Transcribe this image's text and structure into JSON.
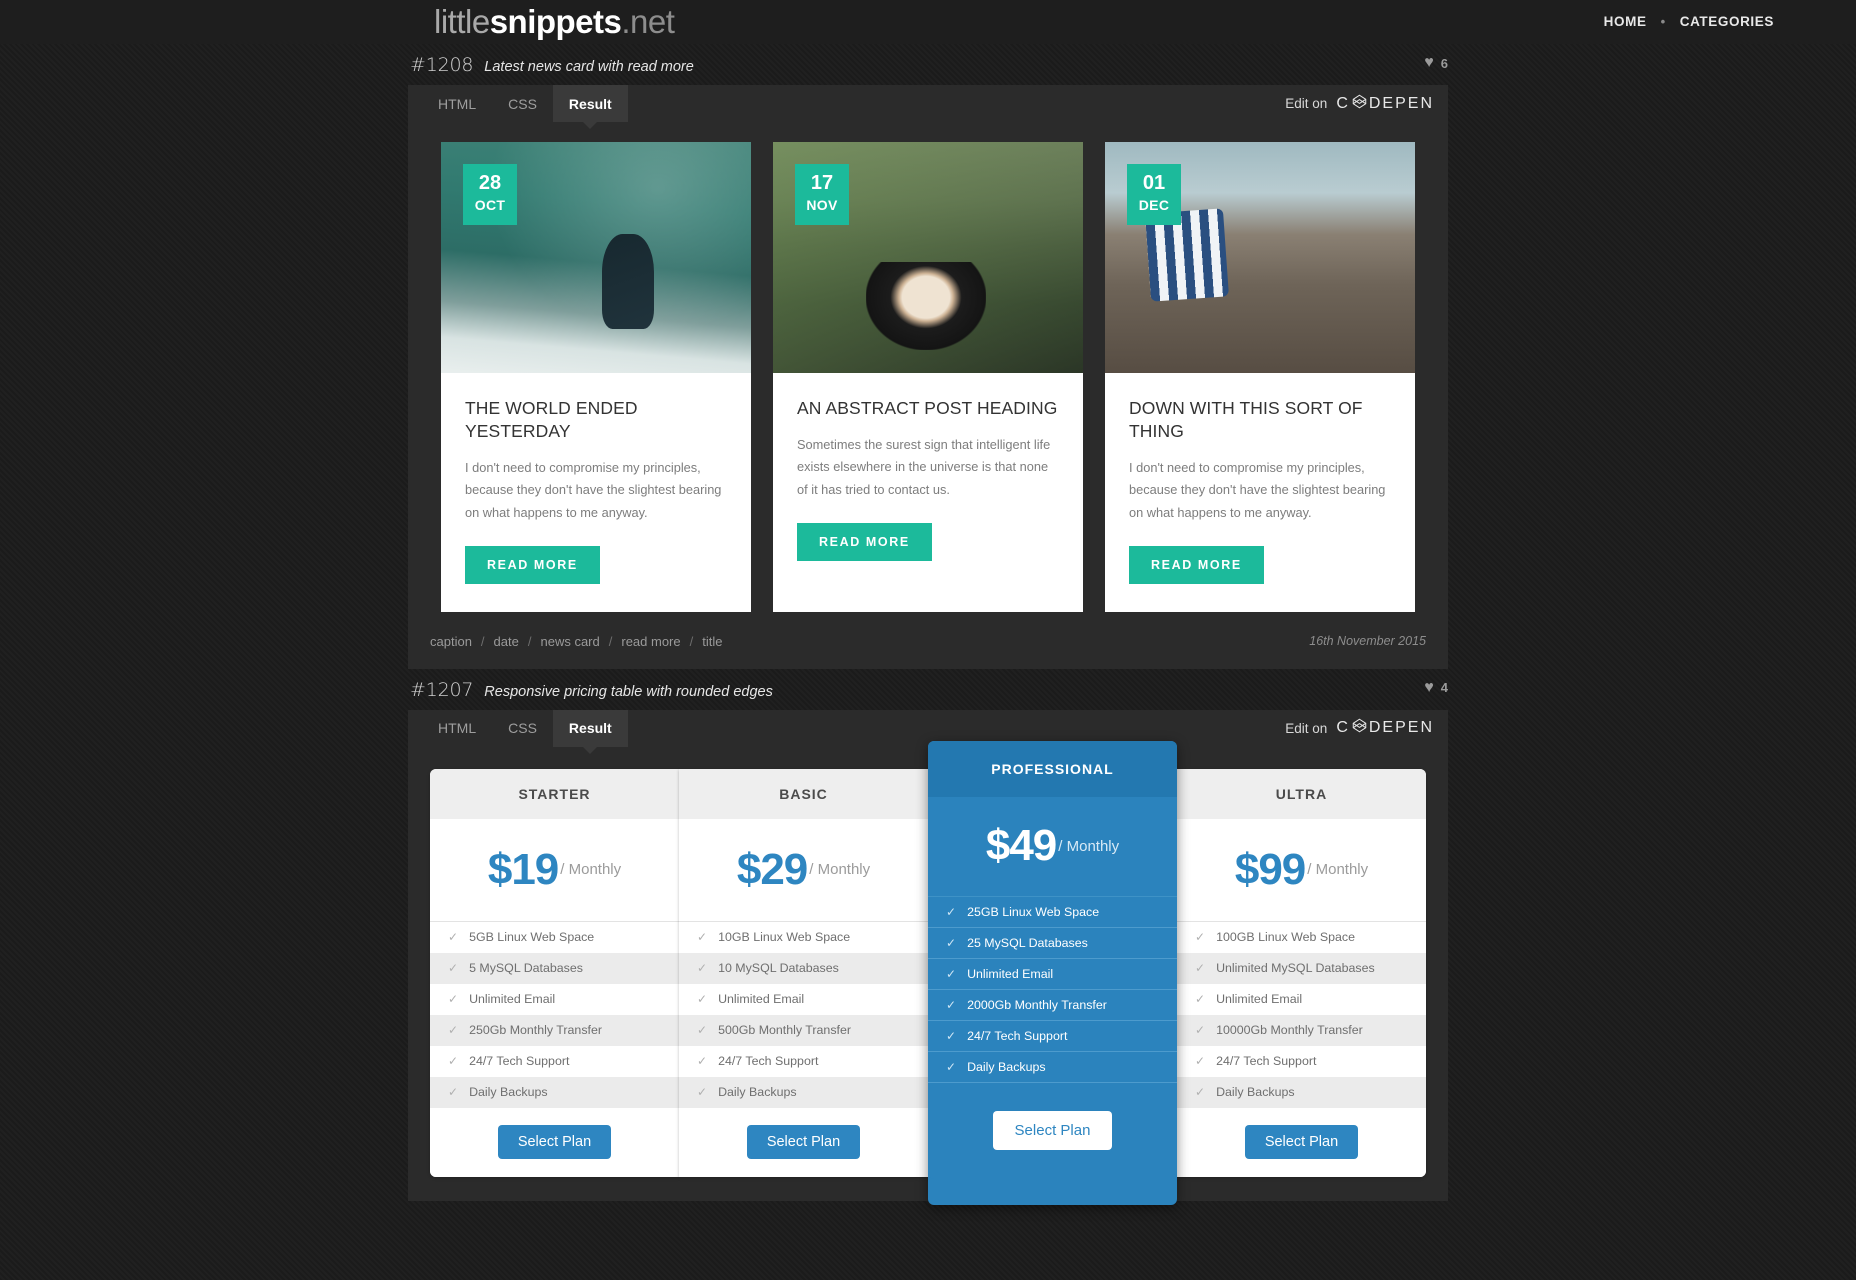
{
  "site": {
    "logo_light": "little",
    "logo_bold": "snippets",
    "logo_tld": ".net",
    "nav": [
      {
        "label": "HOME"
      },
      {
        "label": "CATEGORIES"
      }
    ],
    "nav_separator": "•"
  },
  "snippets": [
    {
      "id": "#1208",
      "title": "Latest news card with read more",
      "likes": "6",
      "tabs": [
        {
          "label": "HTML",
          "active": false
        },
        {
          "label": "CSS",
          "active": false
        },
        {
          "label": "Result",
          "active": true
        }
      ],
      "edit_on": "Edit on",
      "codepen": "CODEPEN",
      "tags": [
        "caption",
        "date",
        "news card",
        "read more",
        "title"
      ],
      "tag_separator": "/",
      "date": "16th November 2015",
      "cards": [
        {
          "day": "28",
          "month": "OCT",
          "title": "THE WORLD ENDED YESTERDAY",
          "text": "I don't need to compromise my principles, because they don't have the slightest bearing on what happens to me anyway.",
          "button": "READ MORE"
        },
        {
          "day": "17",
          "month": "NOV",
          "title": "AN ABSTRACT POST HEADING",
          "text": "Sometimes the surest sign that intelligent life exists elsewhere in the universe is that none of it has tried to contact us.",
          "button": "READ MORE"
        },
        {
          "day": "01",
          "month": "DEC",
          "title": "DOWN WITH THIS SORT OF THING",
          "text": "I don't need to compromise my principles, because they don't have the slightest bearing on what happens to me anyway.",
          "button": "READ MORE"
        }
      ]
    },
    {
      "id": "#1207",
      "title": "Responsive pricing table with rounded edges",
      "likes": "4",
      "tabs": [
        {
          "label": "HTML",
          "active": false
        },
        {
          "label": "CSS",
          "active": false
        },
        {
          "label": "Result",
          "active": true
        }
      ],
      "edit_on": "Edit on",
      "codepen": "CODEPEN",
      "plans": [
        {
          "name": "STARTER",
          "price": "$19",
          "period": "/ Monthly",
          "featured": false,
          "features": [
            "5GB Linux Web Space",
            "5 MySQL Databases",
            "Unlimited Email",
            "250Gb Monthly Transfer",
            "24/7 Tech Support",
            "Daily Backups"
          ],
          "button": "Select Plan"
        },
        {
          "name": "BASIC",
          "price": "$29",
          "period": "/ Monthly",
          "featured": false,
          "features": [
            "10GB Linux Web Space",
            "10 MySQL Databases",
            "Unlimited Email",
            "500Gb Monthly Transfer",
            "24/7 Tech Support",
            "Daily Backups"
          ],
          "button": "Select Plan"
        },
        {
          "name": "PROFESSIONAL",
          "price": "$49",
          "period": "/ Monthly",
          "featured": true,
          "features": [
            "25GB Linux Web Space",
            "25 MySQL Databases",
            "Unlimited Email",
            "2000Gb Monthly Transfer",
            "24/7 Tech Support",
            "Daily Backups"
          ],
          "button": "Select Plan"
        },
        {
          "name": "ULTRA",
          "price": "$99",
          "period": "/ Monthly",
          "featured": false,
          "features": [
            "100GB Linux Web Space",
            "Unlimited MySQL Databases",
            "Unlimited Email",
            "10000Gb Monthly Transfer",
            "24/7 Tech Support",
            "Daily Backups"
          ],
          "button": "Select Plan"
        }
      ]
    }
  ],
  "colors": {
    "accent_teal": "#1cba9b",
    "accent_blue": "#2e86c1",
    "featured_blue": "#2b83bd",
    "panel_bg": "#2b2b2b",
    "page_bg": "#1c1c1c"
  },
  "icons": {
    "heart": "♥",
    "check": "✓"
  }
}
